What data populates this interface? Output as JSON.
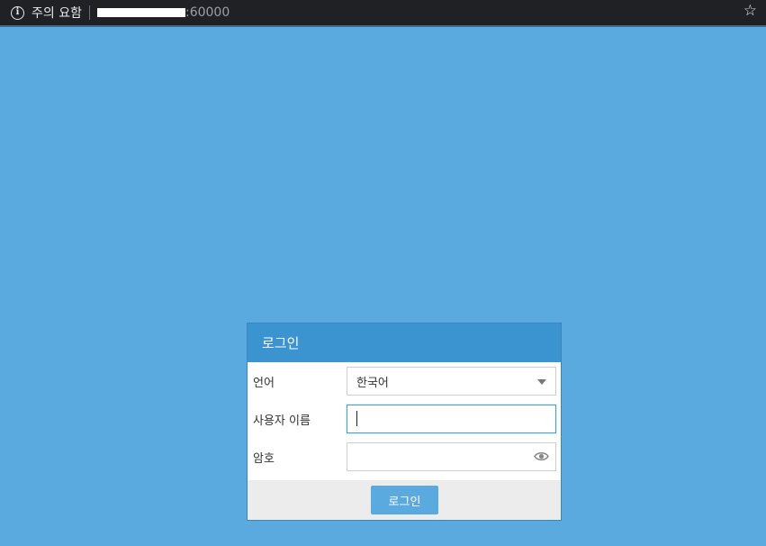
{
  "browser": {
    "security_label": "주의 요함",
    "url_suffix": ":60000"
  },
  "login": {
    "title": "로그인",
    "language_label": "언어",
    "language_value": "한국어",
    "username_label": "사용자 이름",
    "username_value": "",
    "password_label": "암호",
    "password_value": "",
    "submit_label": "로그인"
  },
  "icons": {
    "info": "info-icon",
    "star": "star-icon",
    "eye": "eye-icon",
    "dropdown": "chevron-down-icon"
  },
  "colors": {
    "background": "#5aaae0",
    "header": "#3b93cf",
    "button": "#5aaae0"
  }
}
